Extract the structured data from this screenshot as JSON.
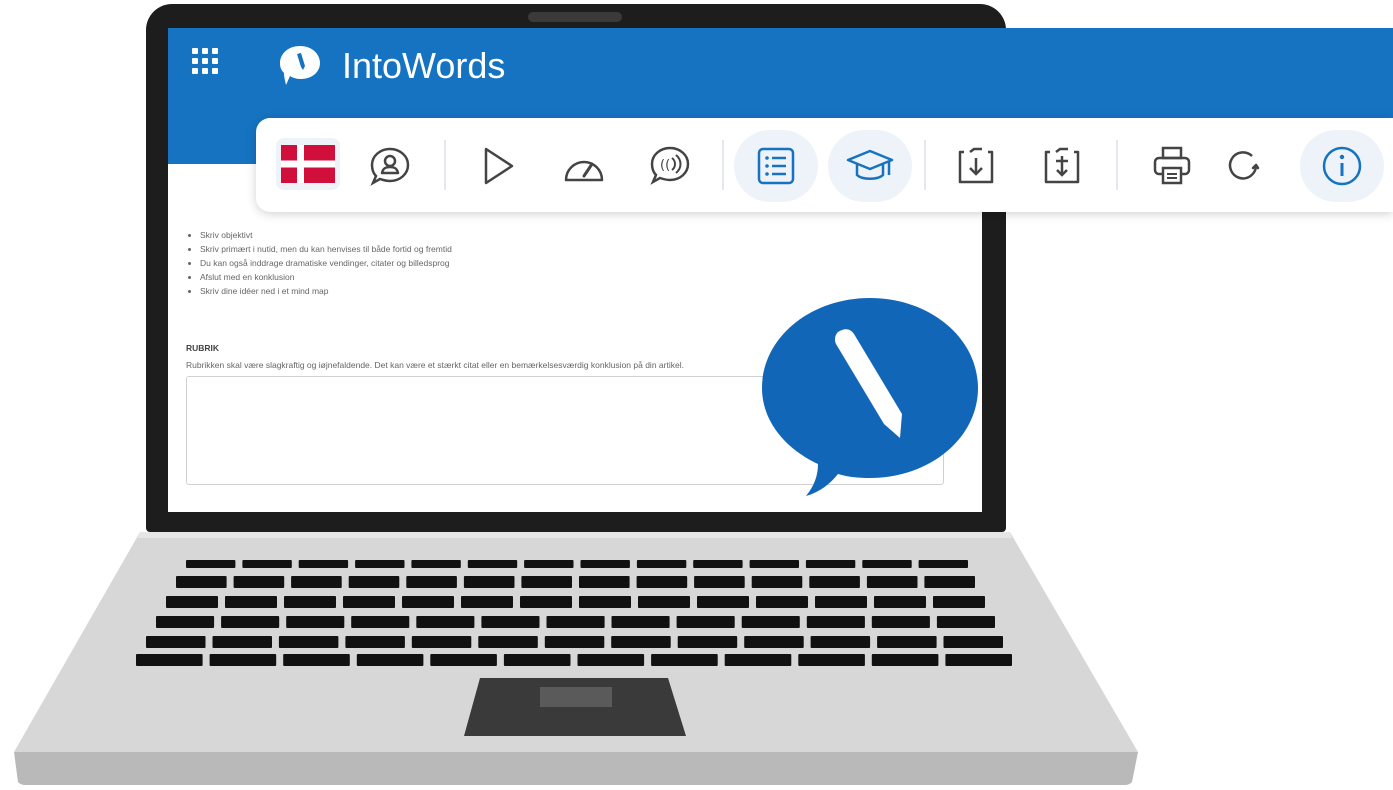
{
  "app": {
    "title": "IntoWords",
    "brand_color": "#1573c1"
  },
  "toolbar": {
    "items": [
      {
        "name": "flag-danish-icon",
        "state": "selected"
      },
      {
        "name": "read-profile-icon"
      },
      {
        "name": "play-icon"
      },
      {
        "name": "speed-gauge-icon"
      },
      {
        "name": "voice-icon"
      },
      {
        "name": "list-icon",
        "state": "active"
      },
      {
        "name": "graduation-cap-icon",
        "state": "active"
      },
      {
        "name": "download-icon"
      },
      {
        "name": "upload-icon"
      },
      {
        "name": "print-icon"
      },
      {
        "name": "refresh-icon"
      },
      {
        "name": "info-icon",
        "state": "active"
      }
    ]
  },
  "document": {
    "bullets": [
      "Skriv objektivt",
      "Skriv primært i nutid, men du kan henvises til både fortid og fremtid",
      "Du kan også inddrage dramatiske vendinger, citater og billedsprog",
      "Afslut med en konklusion",
      "Skriv dine idéer ned i et mind map"
    ],
    "rubrik_heading": "RUBRIK",
    "rubrik_description": "Rubrikken skal være slagkraftig og iøjnefaldende. Det kan være et stærkt citat eller en bemærkelsesværdig konklusion på din artikel."
  }
}
